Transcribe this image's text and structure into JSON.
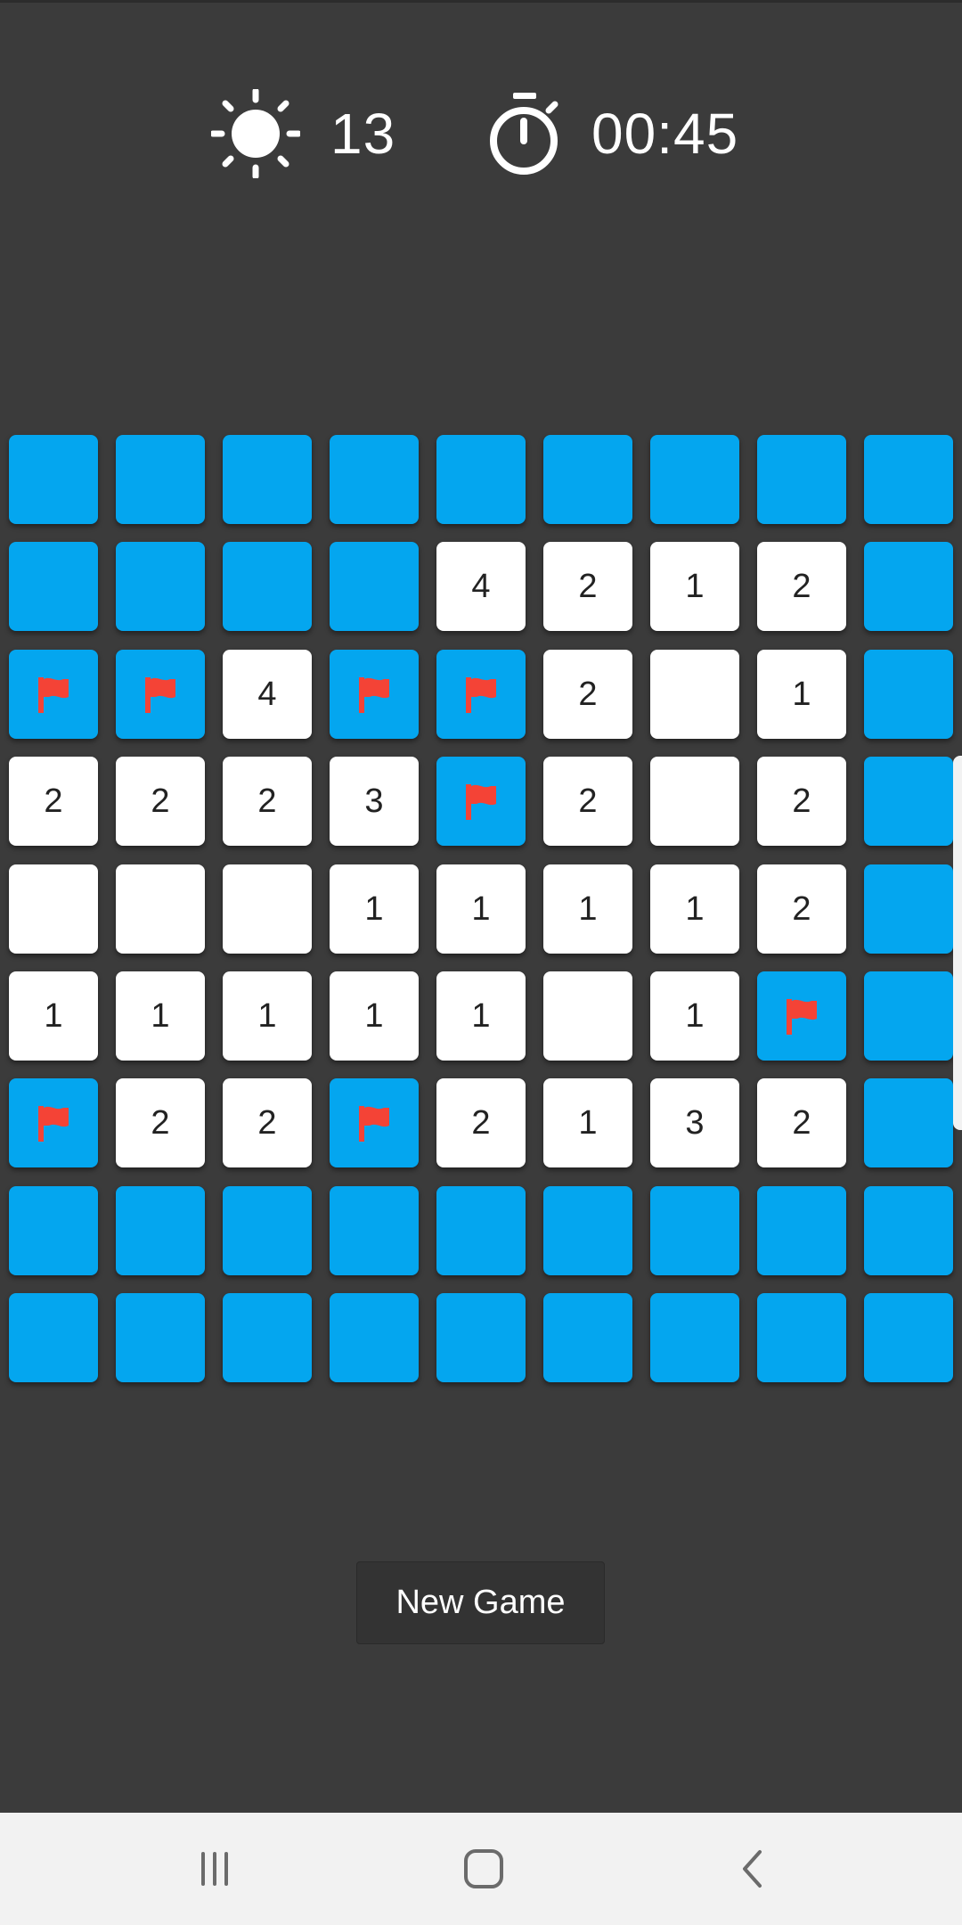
{
  "hud": {
    "mines_remaining": "13",
    "mines_icon": "sun-mine-icon",
    "timer": "00:45",
    "timer_icon": "stopwatch-icon"
  },
  "colors": {
    "background": "#3b3b3b",
    "hidden_tile": "#04a6ef",
    "revealed_tile": "#ffffff",
    "flag": "#f44336",
    "number_text": "#222222"
  },
  "board": {
    "rows": 9,
    "cols": 9,
    "legend": {
      "H": "hidden",
      "F": "flagged",
      "0": "revealed-empty",
      "1-8": "revealed-number"
    },
    "cells": [
      [
        "H",
        "H",
        "H",
        "H",
        "H",
        "H",
        "H",
        "H",
        "H"
      ],
      [
        "H",
        "H",
        "H",
        "H",
        "4",
        "2",
        "1",
        "2",
        "H"
      ],
      [
        "F",
        "F",
        "4",
        "F",
        "F",
        "2",
        "0",
        "1",
        "H"
      ],
      [
        "2",
        "2",
        "2",
        "3",
        "F",
        "2",
        "0",
        "2",
        "H"
      ],
      [
        "0",
        "0",
        "0",
        "1",
        "1",
        "1",
        "1",
        "2",
        "H"
      ],
      [
        "1",
        "1",
        "1",
        "1",
        "1",
        "0",
        "1",
        "F",
        "H"
      ],
      [
        "F",
        "2",
        "2",
        "F",
        "2",
        "1",
        "3",
        "2",
        "H"
      ],
      [
        "H",
        "H",
        "H",
        "H",
        "H",
        "H",
        "H",
        "H",
        "H"
      ],
      [
        "H",
        "H",
        "H",
        "H",
        "H",
        "H",
        "H",
        "H",
        "H"
      ]
    ]
  },
  "actions": {
    "new_game_label": "New Game"
  },
  "navbar": {
    "recents_icon": "recents-icon",
    "home_icon": "home-icon",
    "back_icon": "back-icon"
  }
}
